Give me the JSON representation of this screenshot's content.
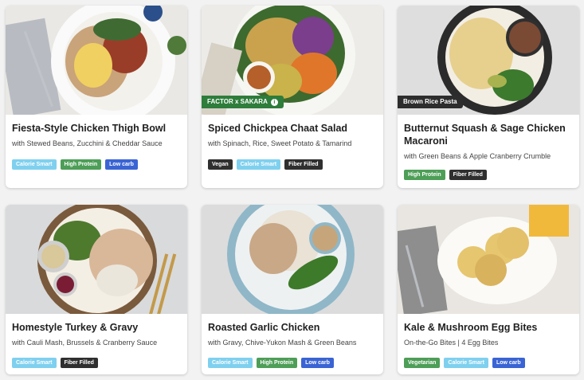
{
  "meals": [
    {
      "title": "Fiesta-Style Chicken Thigh Bowl",
      "subtitle": "with Stewed Beans, Zucchini & Cheddar Sauce",
      "badge": "",
      "tags": [
        "Calorie Smart",
        "High Protein",
        "Low carb"
      ]
    },
    {
      "title": "Spiced Chickpea Chaat Salad",
      "subtitle": "with Spinach, Rice, Sweet Potato & Tamarind",
      "badge": "FACTOR x SAKARA",
      "badge_icon": "info-icon",
      "tags": [
        "Vegan",
        "Calorie Smart",
        "Fiber Filled"
      ]
    },
    {
      "title": "Butternut Squash & Sage Chicken Macaroni",
      "subtitle": "with Green Beans & Apple Cranberry Crumble",
      "badge": "Brown Rice Pasta",
      "tags": [
        "High Protein",
        "Fiber Filled"
      ]
    },
    {
      "title": "Homestyle Turkey & Gravy",
      "subtitle": "with Cauli Mash, Brussels & Cranberry Sauce",
      "badge": "",
      "tags": [
        "Calorie Smart",
        "Fiber Filled"
      ]
    },
    {
      "title": "Roasted Garlic Chicken",
      "subtitle": "with Gravy, Chive-Yukon Mash & Green Beans",
      "badge": "",
      "tags": [
        "Calorie Smart",
        "High Protein",
        "Low carb"
      ]
    },
    {
      "title": "Kale & Mushroom Egg Bites",
      "subtitle": "On-the-Go Bites | 4 Egg Bites",
      "badge": "",
      "tags": [
        "Vegetarian",
        "Calorie Smart",
        "Low carb"
      ]
    }
  ],
  "colors": {
    "calorie_smart": "#7fd0ef",
    "high_protein": "#4d9e57",
    "low_carb": "#3a64d4",
    "fiber_filled": "#2f2f2f",
    "vegan": "#2f2f2f",
    "vegetarian": "#4d9e57",
    "badge_green": "#2e7d3b",
    "badge_dark": "#2d2d2d"
  }
}
